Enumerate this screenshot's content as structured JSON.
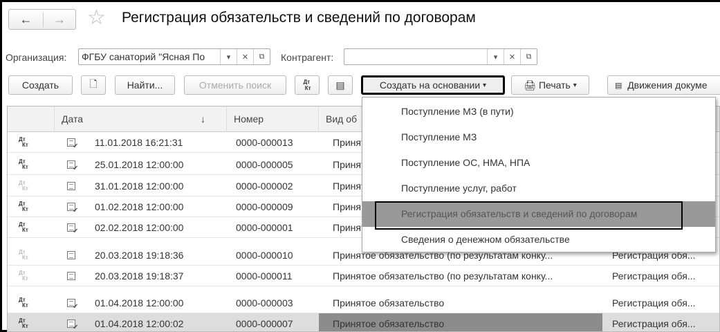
{
  "title": "Регистрация обязательств и сведений по договорам",
  "filters": {
    "org_label": "Организация:",
    "org_value": "ФГБУ санаторий \"Ясная По",
    "contr_label": "Контрагент:",
    "contr_value": ""
  },
  "toolbar": {
    "create": "Создать",
    "find": "Найти...",
    "cancel_search": "Отменить поиск",
    "create_based": "Создать на основании",
    "print": "Печать",
    "movements": "Движения докуме"
  },
  "columns": {
    "date": "Дата",
    "number": "Номер",
    "vid": "Вид об",
    "sort": "↓"
  },
  "rows": [
    {
      "date": "11.01.2018 16:21:31",
      "number": "0000-000013",
      "vid": "Принят",
      "reg": "",
      "posted": true
    },
    {
      "date": "25.01.2018 12:00:00",
      "number": "0000-000005",
      "vid": "Принят",
      "reg": "",
      "posted": true
    },
    {
      "date": "31.01.2018 12:00:00",
      "number": "0000-000002",
      "vid": "Принят",
      "reg": "",
      "posted": false
    },
    {
      "date": "01.02.2018 12:00:00",
      "number": "0000-000009",
      "vid": "Приня",
      "reg": "",
      "posted": true
    },
    {
      "date": "02.02.2018 12:00:00",
      "number": "0000-000001",
      "vid": "Принят",
      "reg": "",
      "posted": true
    },
    {
      "date": "20.03.2018 19:18:36",
      "number": "0000-000010",
      "vid": "Принятое обязательство (по результатам конку...",
      "reg": "Регистрация обя...",
      "posted": false
    },
    {
      "date": "20.03.2018 19:18:37",
      "number": "0000-000011",
      "vid": "Принятое обязательство (по результатам конку...",
      "reg": "Регистрация обя...",
      "posted": false
    },
    {
      "date": "01.04.2018 12:00:00",
      "number": "0000-000003",
      "vid": "Принятое обязательство",
      "reg": "Регистрация обя...",
      "posted": true
    },
    {
      "date": "01.04.2018 12:00:02",
      "number": "0000-000007",
      "vid": "Принятое обязательство",
      "reg": "Регистрация обя...",
      "posted": true
    }
  ],
  "menu": [
    "Поступление МЗ (в пути)",
    "Поступление МЗ",
    "Поступление ОС, НМА, НПА",
    "Поступление услуг, работ",
    "Регистрация обязательств и сведений по договорам",
    "Сведения о денежном обязательстве"
  ],
  "icons": {
    "dtkt_top": "Дт",
    "dtkt_bottom": "Кт"
  }
}
